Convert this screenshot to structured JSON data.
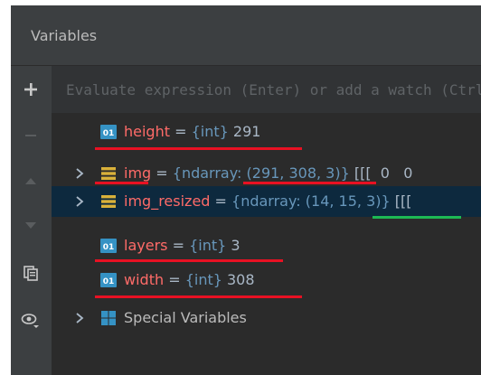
{
  "panel": {
    "title": "Variables"
  },
  "evaluate": {
    "placeholder": "Evaluate expression (Enter) or add a watch (Ctrl+Shift+Enter)"
  },
  "variables": [
    {
      "icon": "int-type-icon",
      "icon_label": "01",
      "name": "height",
      "eq": " = ",
      "type": "{int}",
      "value": " 291",
      "expandable": false,
      "selected": false
    },
    {
      "icon": "ndarray-type-icon",
      "name": "img",
      "eq": " = ",
      "type": "{ndarray: ",
      "shape": "(291, 308, 3)",
      "type_close": "}",
      "value": " [[[  0   0",
      "expandable": true,
      "selected": false
    },
    {
      "icon": "ndarray-type-icon",
      "name": "img_resized",
      "eq": " = ",
      "type": "{ndarray: ",
      "shape": "(14, 15, 3)",
      "type_close": "}",
      "value": " [[[",
      "expandable": true,
      "selected": true
    },
    {
      "icon": "int-type-icon",
      "icon_label": "01",
      "name": "layers",
      "eq": " = ",
      "type": "{int}",
      "value": " 3",
      "expandable": false,
      "selected": false
    },
    {
      "icon": "int-type-icon",
      "icon_label": "01",
      "name": "width",
      "eq": " = ",
      "type": "{int}",
      "value": " 308",
      "expandable": false,
      "selected": false
    },
    {
      "icon": "special-vars-icon",
      "name": "Special Variables",
      "expandable": true,
      "selected": false
    }
  ],
  "colors": {
    "panel_bg": "#3c3f41",
    "content_bg": "#2b2b2b",
    "selection_bg": "#0d293e",
    "var_name": "#ff6b68",
    "var_type": "#6897bb",
    "underline_red": "#e81123",
    "underline_green": "#1db954"
  }
}
